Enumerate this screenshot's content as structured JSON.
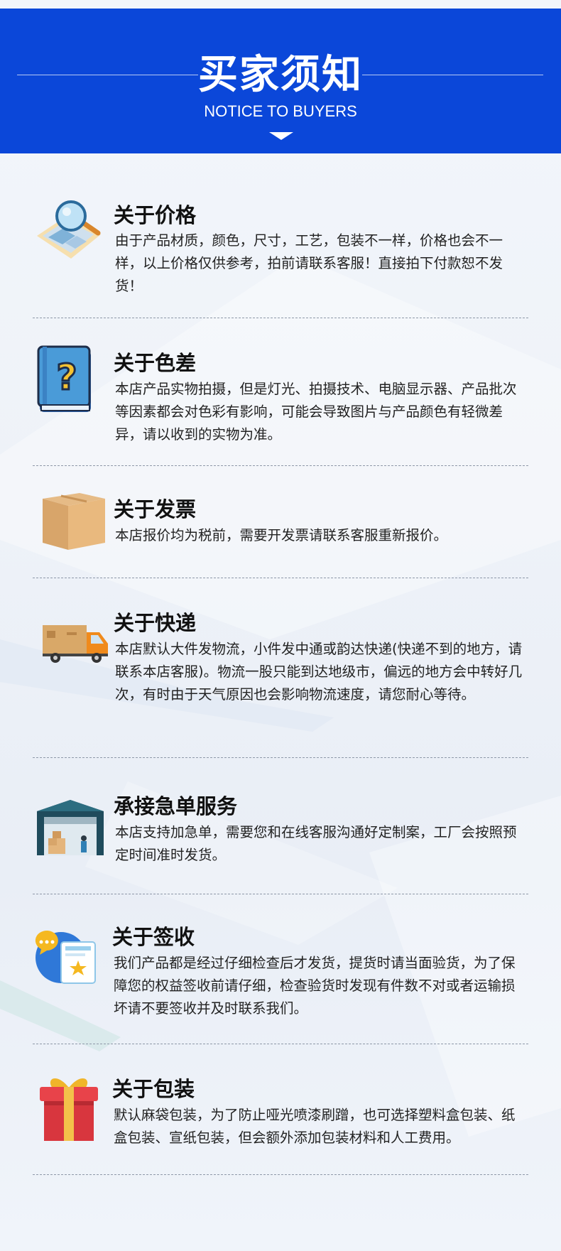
{
  "header": {
    "title": "买家须知",
    "subtitle": "NOTICE TO BUYERS"
  },
  "sections": [
    {
      "title": "关于价格",
      "body": "由于产品材质，颜色，尺寸，工艺，包装不一样，价格也会不一样，以上价格仅供参考，拍前请联系客服！直接拍下付款恕不发货！",
      "icon": "magnifier-map-icon"
    },
    {
      "title": "关于色差",
      "body": "本店产品实物拍摄，但是灯光、拍摄技术、电脑显示器、产品批次等因素都会对色彩有影响，可能会导致图片与产品颜色有轻微差异，请以收到的实物为准。",
      "icon": "question-book-icon"
    },
    {
      "title": "关于发票",
      "body": "本店报价均为税前，需要开发票请联系客服重新报价。",
      "icon": "cardboard-box-icon"
    },
    {
      "title": "关于快递",
      "body": "本店默认大件发物流，小件发中通或韵达快递(快递不到的地方，请联系本店客服)。物流一股只能到达地级市，偏远的地方会中转好几次，有时由于天气原因也会影响物流速度，请您耐心等待。",
      "icon": "delivery-truck-icon"
    },
    {
      "title": "承接急单服务",
      "body": "本店支持加急单，需要您和在线客服沟通好定制案，工厂会按照预定时间准时发货。",
      "icon": "warehouse-icon"
    },
    {
      "title": "关于签收",
      "body": "我们产品都是经过仔细检查后才发货，提货时请当面验货，为了保障您的权益签收前请仔细，检查验货时发现有件数不对或者运输损坏请不要签收并及时联系我们。",
      "icon": "chat-document-star-icon"
    },
    {
      "title": "关于包装",
      "body": "默认麻袋包装，为了防止哑光喷漆刷蹭，也可选择塑料盒包装、纸盒包装、宣纸包装，但会额外添加包装材料和人工费用。",
      "icon": "gift-box-icon"
    }
  ],
  "colors": {
    "header_bg": "#0b47d9",
    "page_bg": "#eef2f8",
    "divider": "#8e98a8"
  }
}
